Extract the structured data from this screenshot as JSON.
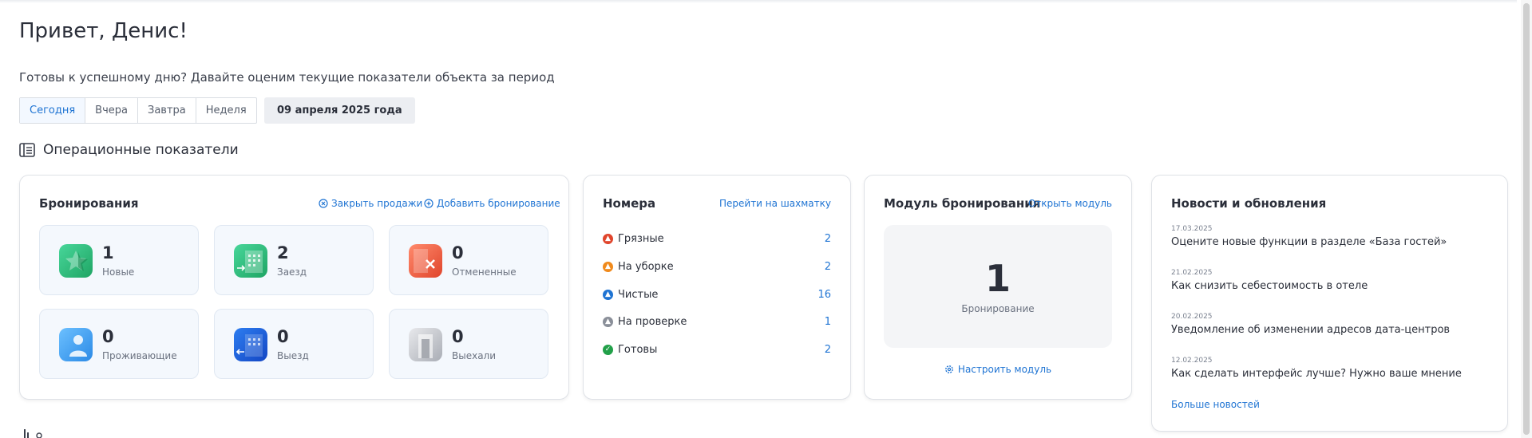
{
  "greeting": "Привет, Денис!",
  "subtitle": "Готовы к успешному дню? Давайте оценим текущие показатели объекта за период",
  "period_tabs": [
    {
      "label": "Сегодня",
      "active": true
    },
    {
      "label": "Вчера",
      "active": false
    },
    {
      "label": "Завтра",
      "active": false
    },
    {
      "label": "Неделя",
      "active": false
    }
  ],
  "selected_date": "09 апреля 2025 года",
  "section_title": "Операционные показатели",
  "bookings": {
    "title": "Бронирования",
    "close_sales_label": "Закрыть продажи",
    "add_booking_label": "Добавить бронирование",
    "stats": [
      {
        "value": "1",
        "label": "Новые",
        "icon": "star-icon"
      },
      {
        "value": "2",
        "label": "Заезд",
        "icon": "check-in-icon"
      },
      {
        "value": "0",
        "label": "Отмененные",
        "icon": "cancel-icon"
      },
      {
        "value": "0",
        "label": "Проживающие",
        "icon": "guest-icon"
      },
      {
        "value": "0",
        "label": "Выезд",
        "icon": "check-out-icon"
      },
      {
        "value": "0",
        "label": "Выехали",
        "icon": "door-icon"
      }
    ]
  },
  "rooms": {
    "title": "Номера",
    "link_label": "Перейти на шахматку",
    "items": [
      {
        "label": "Грязные",
        "count": "2",
        "color": "#e0452c"
      },
      {
        "label": "На уборке",
        "count": "2",
        "color": "#f08a1c"
      },
      {
        "label": "Чистые",
        "count": "16",
        "color": "#1f74d3"
      },
      {
        "label": "На проверке",
        "count": "1",
        "color": "#8a8f99"
      },
      {
        "label": "Готовы",
        "count": "2",
        "color": "#22a049"
      }
    ]
  },
  "module": {
    "title": "Модуль бронирования",
    "open_label": "Открыть модуль",
    "count": "1",
    "count_label": "Бронирование",
    "configure_label": "Настроить модуль"
  },
  "news": {
    "title": "Новости и обновления",
    "items": [
      {
        "date": "17.03.2025",
        "title": "Оцените новые функции в разделе «База гостей»"
      },
      {
        "date": "21.02.2025",
        "title": "Как снизить себестоимость в отеле"
      },
      {
        "date": "20.02.2025",
        "title": "Уведомление об изменении адресов дата-центров"
      },
      {
        "date": "12.02.2025",
        "title": "Как сделать интерфейс лучше? Нужно ваше мнение"
      }
    ],
    "more_label": "Больше новостей"
  },
  "colors": {
    "accent": "#1f74d3",
    "text": "#2b2f3a"
  }
}
